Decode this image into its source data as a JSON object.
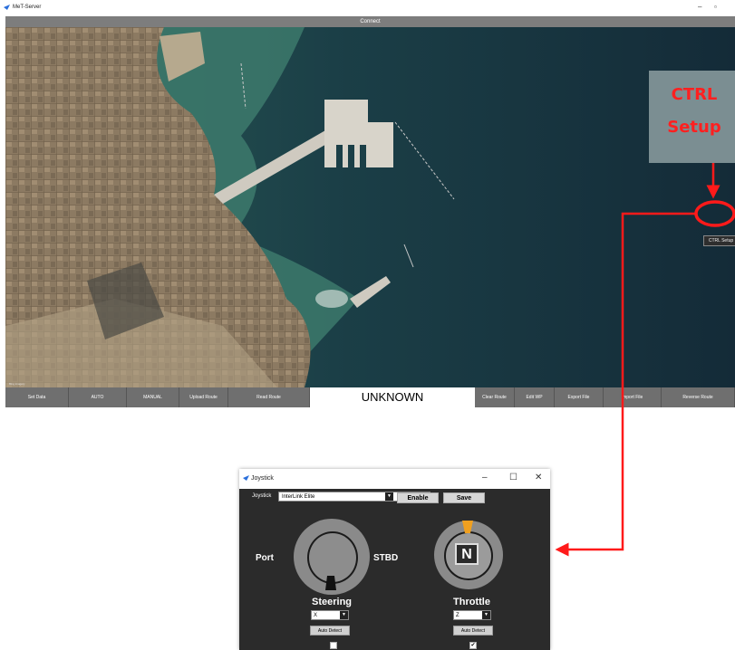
{
  "main_window": {
    "title": "MeT-Server",
    "connect_label": "Connect",
    "ctrl_setup_label": "CTRL Setup",
    "map_attribution": "Bing imagery"
  },
  "bottom_bar": {
    "buttons": [
      "Set Data",
      "AUTO",
      "MANUAL",
      "Upload Route",
      "Read Route"
    ],
    "status": "UNKNOWN",
    "buttons_right": [
      "Clear Route",
      "Edit WP",
      "Export File",
      "Import File",
      "Reverse Route"
    ]
  },
  "callout": {
    "line1": "CTRL",
    "line2": "Setup"
  },
  "joystick": {
    "title": "Joystick",
    "joystick_label": "Joystick",
    "device": "InterLink Elite",
    "enable_label": "Enable",
    "save_label": "Save",
    "port_label": "Port",
    "stbd_label": "STBD",
    "gear_label": "N",
    "steering_label": "Steering",
    "throttle_label": "Throttle",
    "steering_axis": "X",
    "throttle_axis": "Z",
    "auto_detect_label": "Auto Detect",
    "steering_reverse_checked": "",
    "throttle_reverse_checked": "✔"
  },
  "colors": {
    "annotation_red": "#ff1a1a",
    "callout_bg": "#7b8e92",
    "dark_bg": "#2b2b2b"
  }
}
